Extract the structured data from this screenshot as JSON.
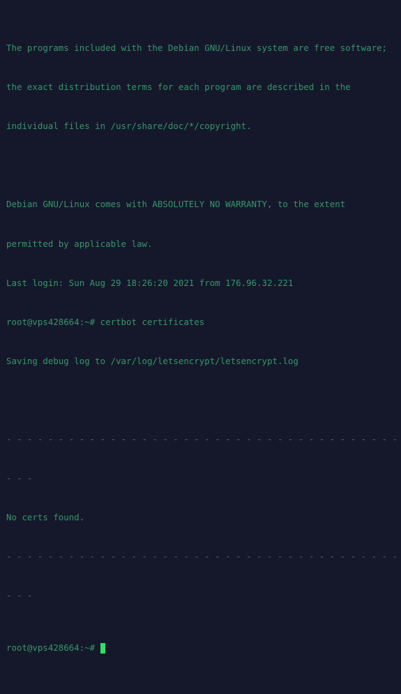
{
  "terminal": {
    "background_color": "#15182a",
    "text_color": "#36966c",
    "separator_color": "#55656b",
    "cursor_color": "#2ee06a",
    "lines": [
      {
        "kind": "text",
        "text": "The programs included with the Debian GNU/Linux system are free software;"
      },
      {
        "kind": "text",
        "text": "the exact distribution terms for each program are described in the"
      },
      {
        "kind": "text",
        "text": "individual files in /usr/share/doc/*/copyright."
      },
      {
        "kind": "blank",
        "text": ""
      },
      {
        "kind": "text",
        "text": "Debian GNU/Linux comes with ABSOLUTELY NO WARRANTY, to the extent"
      },
      {
        "kind": "text",
        "text": "permitted by applicable law."
      },
      {
        "kind": "text",
        "text": "Last login: Sun Aug 29 18:26:20 2021 from 176.96.32.221"
      },
      {
        "kind": "text",
        "text": "root@vps428664:~# certbot certificates"
      },
      {
        "kind": "text",
        "text": "Saving debug log to /var/log/letsencrypt/letsencrypt.log"
      },
      {
        "kind": "blank",
        "text": ""
      },
      {
        "kind": "sep",
        "text": "- - - - - - - - - - - - - - - - - - - - - - - - - - - - - - - - - - - - - -"
      },
      {
        "kind": "sep",
        "text": "- - -"
      },
      {
        "kind": "text",
        "text": "No certs found."
      },
      {
        "kind": "sep",
        "text": "- - - - - - - - - - - - - - - - - - - - - - - - - - - - - - - - - - - - - -"
      },
      {
        "kind": "sep",
        "text": "- - -"
      }
    ],
    "final_prompt": "root@vps428664:~#",
    "cursor": "block-cursor"
  }
}
